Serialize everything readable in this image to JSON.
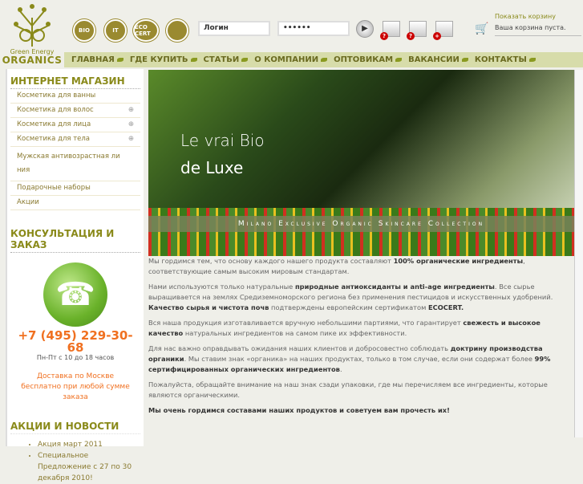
{
  "logo": {
    "line1": "Green Energy",
    "line2": "ORGANICS"
  },
  "badges": [
    "BIO",
    "IT",
    "ECO CERT",
    "rabbit"
  ],
  "login": {
    "login_value": "Логин",
    "password_value": "••••••"
  },
  "cart": {
    "show_link": "Показать корзину",
    "status": "Ваша корзина пуста."
  },
  "nav": [
    "ГЛАВНАЯ",
    "ГДЕ КУПИТЬ",
    "СТАТЬИ",
    "О КОМПАНИИ",
    "ОПТОВИКАМ",
    "ВАКАНСИИ",
    "КОНТАКТЫ"
  ],
  "sidebar": {
    "shop_title": "ИНТЕРНЕТ МАГАЗИН",
    "shop_items": [
      {
        "label": "Косметика для ванны",
        "expand": ""
      },
      {
        "label": "Косметика для волос",
        "expand": "⊕"
      },
      {
        "label": "Косметика для лица",
        "expand": "⊕"
      },
      {
        "label": "Косметика для тела",
        "expand": "⊕"
      },
      {
        "label": "Мужская антивозрастная линия",
        "expand": ""
      },
      {
        "label": "Подарочные наборы",
        "expand": ""
      },
      {
        "label": "Акции",
        "expand": ""
      }
    ],
    "consult_title": "КОНСУЛЬТАЦИЯ И ЗАКАЗ",
    "phone": "+7 (495) 229-30-68",
    "hours": "Пн-Пт с 10 до 18 часов",
    "delivery": "Доставка по Москве бесплатно при любой сумме заказа",
    "news_title": "АКЦИИ И НОВОСТИ",
    "news": [
      "Акция март 2011",
      "Специальное Предложение с 27 по 30 декабря 2010!"
    ]
  },
  "hero": {
    "line1": "Le vrai Bio",
    "line2": "de Luxe",
    "band": "Milano Exclusive Organic Skincare Collection"
  },
  "content": {
    "p1": [
      "Мы гордимся тем, что основу каждого нашего продукта составляют ",
      "100% органические ингредиенты",
      ", соответствующие самым высоким мировым стандартам."
    ],
    "p2": [
      "Нами используются только натуральные ",
      "природные антиоксиданты и anti-age ингредиенты",
      ". Все сырье выращивается на землях Средиземноморского региона без применения пестицидов и искусственных удобрений. ",
      "Качество сырья и чистота почв",
      " подтверждены европейским сертификатом ",
      "ECOCERT."
    ],
    "p3": [
      "Вся наша продукция изготавливается вручную небольшими партиями, что гарантирует ",
      "свежесть и высокое качество",
      " натуральных ингредиентов на самом пике их эффективности."
    ],
    "p4": [
      "Для нас важно оправдывать ожидания наших клиентов и добросовестно соблюдать ",
      "доктрину производства органики",
      ". Мы ставим знак «органика» на наших продуктах, только в том случае, если они содержат более ",
      "99% сертифицированных органических ингредиентов",
      "."
    ],
    "p5": "Пожалуйста, обращайте внимание на наш знак сзади упаковки, где мы перечисляем все ингредиенты, которые являются органическими.",
    "p6": "Мы очень гордимся составами наших продуктов и советуем вам прочесть их!"
  }
}
